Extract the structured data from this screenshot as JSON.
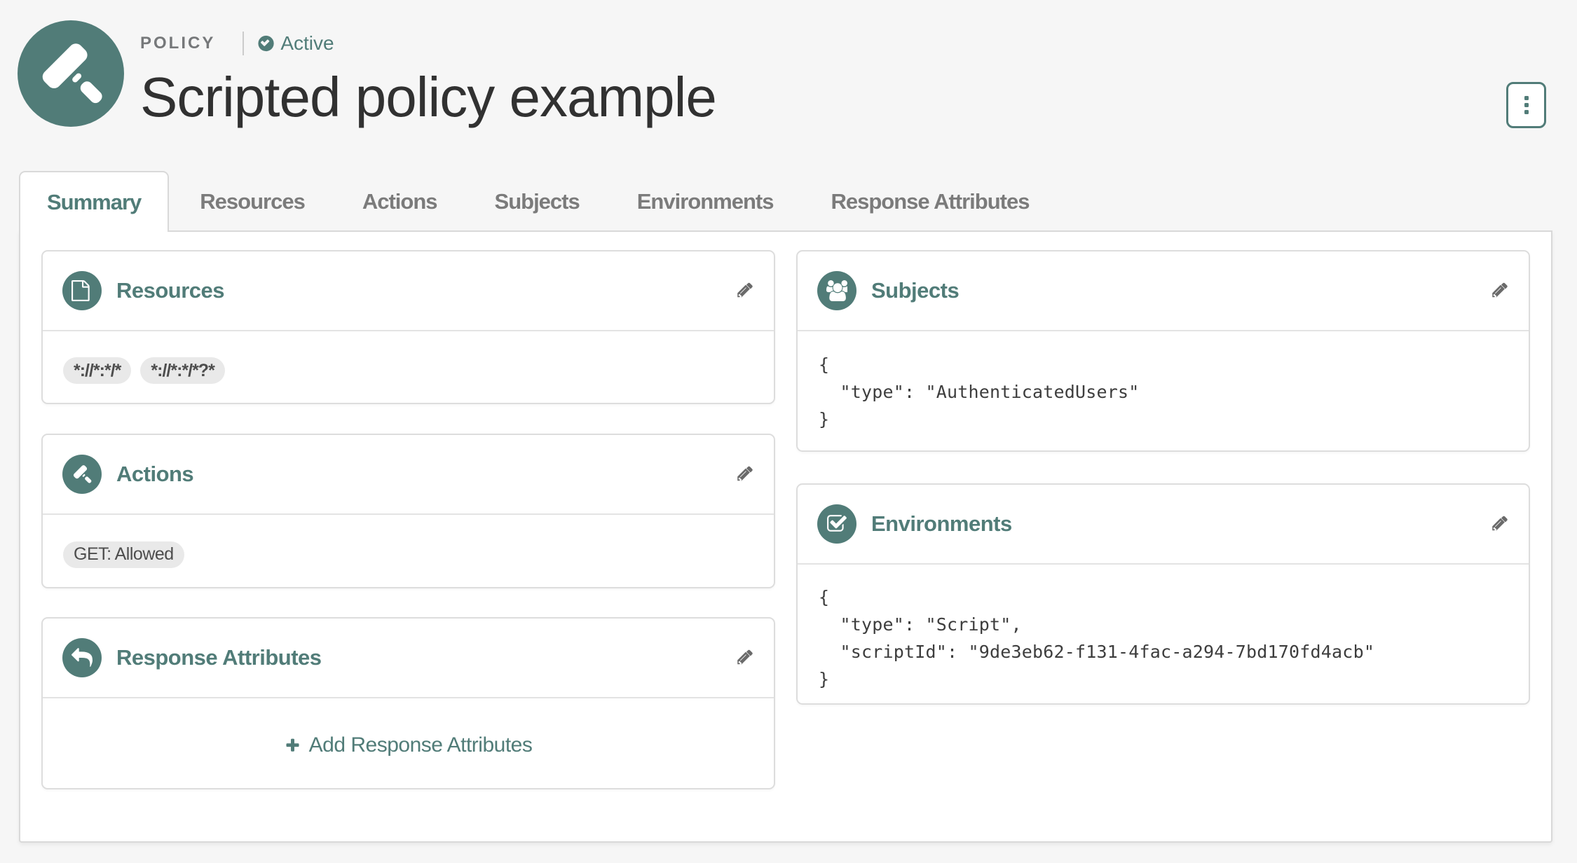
{
  "accent_color": "#517c78",
  "header": {
    "type_label": "POLICY",
    "status": {
      "icon": "check-circle-icon",
      "label": "Active"
    },
    "title": "Scripted policy example",
    "avatar_icon": "gavel-icon",
    "more_button_icon": "kebab-menu-icon"
  },
  "tabs": [
    {
      "label": "Summary",
      "active": true
    },
    {
      "label": "Resources",
      "active": false
    },
    {
      "label": "Actions",
      "active": false
    },
    {
      "label": "Subjects",
      "active": false
    },
    {
      "label": "Environments",
      "active": false
    },
    {
      "label": "Response Attributes",
      "active": false
    }
  ],
  "cards": {
    "resources": {
      "title": "Resources",
      "icon": "file-icon",
      "edit_icon": "pencil-icon",
      "tags": [
        "*://*:*/*",
        "*://*:*/*?*"
      ]
    },
    "actions": {
      "title": "Actions",
      "icon": "gavel-icon",
      "edit_icon": "pencil-icon",
      "tags": [
        "GET: Allowed"
      ]
    },
    "response_attributes": {
      "title": "Response Attributes",
      "icon": "reply-icon",
      "edit_icon": "pencil-icon",
      "add_label": "Add Response Attributes",
      "add_icon": "plus-icon"
    },
    "subjects": {
      "title": "Subjects",
      "icon": "users-icon",
      "edit_icon": "pencil-icon",
      "code": "{\n  \"type\": \"AuthenticatedUsers\"\n}"
    },
    "environments": {
      "title": "Environments",
      "icon": "check-square-icon",
      "edit_icon": "pencil-icon",
      "code": "{\n  \"type\": \"Script\",\n  \"scriptId\": \"9de3eb62-f131-4fac-a294-7bd170fd4acb\"\n}"
    }
  }
}
